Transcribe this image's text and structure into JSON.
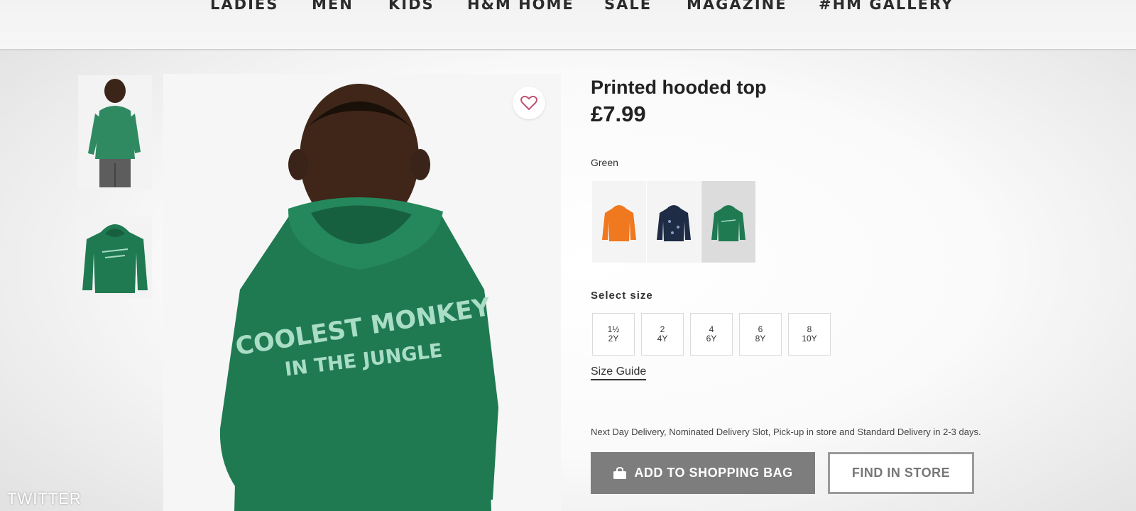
{
  "nav": {
    "items": [
      "LADIES",
      "MEN",
      "KIDS",
      "H&M HOME",
      "SALE",
      "MAGAZINE",
      "#HM GALLERY"
    ]
  },
  "product": {
    "title": "Printed hooded top",
    "price": "£7.99",
    "print_line1": "COOLEST MONKEY",
    "print_line2": "IN THE JUNGLE"
  },
  "colors": {
    "label": "Green",
    "swatches": [
      {
        "name": "orange",
        "hex": "#f0781e"
      },
      {
        "name": "dark-blue",
        "hex": "#1e2c45"
      },
      {
        "name": "green",
        "hex": "#1f7a52",
        "selected": true
      }
    ]
  },
  "sizes": {
    "label": "Select size",
    "options": [
      {
        "line1": "1½",
        "line2": "2Y"
      },
      {
        "line1": "2",
        "line2": "4Y"
      },
      {
        "line1": "4",
        "line2": "6Y"
      },
      {
        "line1": "6",
        "line2": "8Y"
      },
      {
        "line1": "8",
        "line2": "10Y"
      }
    ],
    "guide": "Size Guide"
  },
  "delivery_text": "Next Day Delivery, Nominated Delivery Slot, Pick-up in store and Standard Delivery in 2-3 days.",
  "buttons": {
    "add_to_bag": "ADD TO SHOPPING BAG",
    "find_in_store": "FIND IN STORE"
  },
  "watermark": "TWITTER",
  "theme": {
    "hoodie_green": "#1f7a52",
    "button_grey": "#7d7d7d"
  },
  "icons": {
    "favorite": "heart-icon",
    "bag": "shopping-bag-icon"
  }
}
